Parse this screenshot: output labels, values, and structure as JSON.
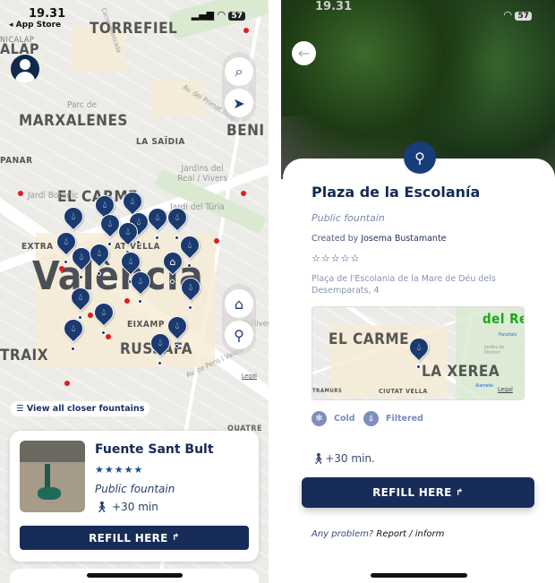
{
  "status_bar": {
    "time": "19.31",
    "back_app": "App Store",
    "battery": "57"
  },
  "map": {
    "labels": [
      "TORREFIEL",
      "ALAP",
      "NICALAP",
      "MARXALENES",
      "LA SAÏDIA",
      "BENI",
      "EL CARME",
      "EXTRA",
      "AT VELLA",
      "València",
      "EIXAMP",
      "RUSSAFA",
      "TRAIX",
      "QUATRE",
      "PANAR"
    ],
    "small_labels": [
      "Parc de",
      "Jardins del Real / Vivers",
      "Jardí Botànic",
      "Jardí del Túria",
      "Av. del Primat Reig",
      "Av. de Peris i Valero",
      "Carrer Montcada",
      "P. Gulliver"
    ],
    "legal": "Legal",
    "search_icon": "search-icon",
    "locate_icon": "navigation-arrow-icon",
    "add_place_icon": "house-plus-icon",
    "add_fountain_icon": "tap-plus-icon"
  },
  "view_all": {
    "label": "View all closer fountains",
    "icon": "list-icon"
  },
  "card": {
    "title": "Fuente Sant Bult",
    "rating": 5,
    "stars": "★★★★★",
    "type": "Public fountain",
    "walk": "+30 min",
    "refill": "REFILL HERE"
  },
  "detail": {
    "title": "Plaza de la Escolanía",
    "type": "Public fountain",
    "created_prefix": "Created by",
    "created_by": "Josema Bustamante",
    "rating": 0,
    "stars": "☆☆☆☆☆",
    "address": "Plaça de l'Escolania de la Mare de Déu dels Desemparats, 4",
    "minimap_labels": [
      "EL CARME",
      "LA XEREA",
      "CIUTAT VELLA",
      "del Re",
      "TRAMURS",
      "Facultats",
      "Alameda",
      "Jardins de Monfort"
    ],
    "minimap_legal": "Legal",
    "features": [
      {
        "label": "Cold",
        "icon": "snowflake-icon"
      },
      {
        "label": "Filtered",
        "icon": "filter-drop-icon"
      }
    ],
    "walk": "+30 min.",
    "refill": "REFILL HERE",
    "problem_prefix": "Any problem?",
    "problem_link": "Report / inform"
  },
  "colors": {
    "primary": "#172c59",
    "pin": "#1a3a70",
    "accent": "#7f8fbd"
  }
}
